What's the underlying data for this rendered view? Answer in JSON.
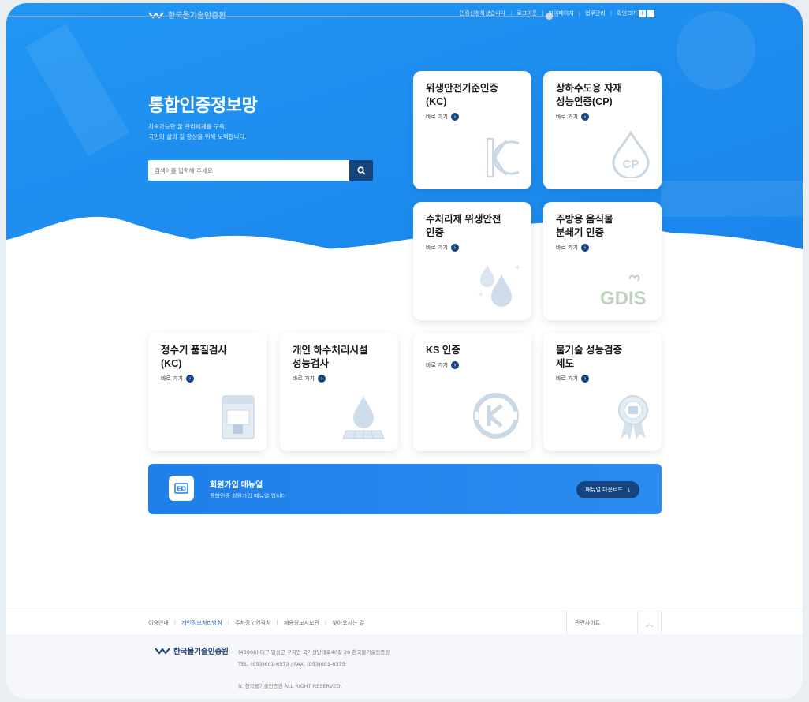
{
  "header": {
    "org_name": "한국물기술인증원",
    "utility_links": [
      "인증신청하셨습니다",
      "로그아웃",
      "마이페이지",
      "업무관리"
    ],
    "zoom_label": "확인크기",
    "zoom_plus": "+",
    "zoom_minus": "-"
  },
  "hero": {
    "title": "통합인증정보망",
    "desc_line1": "지속가능한 물 관리체계를 구축,",
    "desc_line2": "국민의 삶의 질 향상을 위해 노력합니다.",
    "search_placeholder": "검색어를 입력해 주세요"
  },
  "go_label": "바로 가기",
  "cards": [
    {
      "title_l1": "위생안전기준인증",
      "title_l2": "(KC)"
    },
    {
      "title_l1": "상하수도용 자재",
      "title_l2": "성능인증(CP)"
    },
    {
      "title_l1": "수처리제 위생안전",
      "title_l2": "인증"
    },
    {
      "title_l1": "주방용 음식물",
      "title_l2": "분쇄기 인증"
    },
    {
      "title_l1": "정수기 품질검사",
      "title_l2": "(KC)"
    },
    {
      "title_l1": "개인 하수처리시설",
      "title_l2": "성능검사"
    },
    {
      "title_l1": "KS 인증",
      "title_l2": ""
    },
    {
      "title_l1": "물기술 성능검증",
      "title_l2": "제도"
    }
  ],
  "icon_text": {
    "cp": "CP",
    "gdis": "GDIS",
    "banner_icon": "ED"
  },
  "banner": {
    "title": "회원가입 매뉴얼",
    "desc": "통합인증 회원가입 매뉴얼 입니다",
    "button": "매뉴얼 다운로드"
  },
  "footer": {
    "links": [
      "이용안내",
      "개인정보처리방침",
      "주차장 / 연락처",
      "체용정보시보관",
      "찾아오시는 길"
    ],
    "related": "관련사이트",
    "org_name": "한국물기술인증원",
    "address": "(43008) 대구 달성군 구지면 국가산단대로40길 20 한국물기술인증원",
    "phone": "TEL. (053)601-6373 / FAX. (053)601-6375",
    "copyright": "(c)한국물기술인증원 ALL RIGHT RESERVED."
  },
  "colors": {
    "hero_blue": "#1e8cf0",
    "navy": "#16447e",
    "banner_blue": "#2a8cf0"
  }
}
